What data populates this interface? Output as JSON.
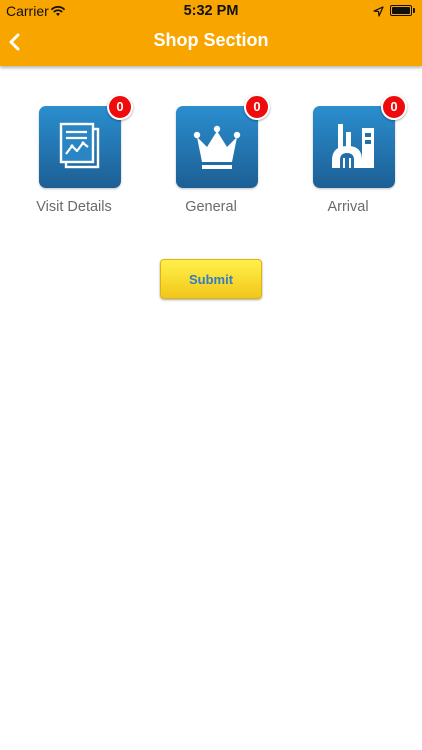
{
  "status_bar": {
    "carrier": "Carrier",
    "time": "5:32 PM"
  },
  "header": {
    "title": "Shop Section",
    "back_icon": "chevron-left-icon",
    "background_color": "#f9a500"
  },
  "tiles": [
    {
      "label": "Visit Details",
      "badge": "0",
      "icon": "document-chart-icon"
    },
    {
      "label": "General",
      "badge": "0",
      "icon": "crown-icon"
    },
    {
      "label": "Arrival",
      "badge": "0",
      "icon": "factory-icon"
    }
  ],
  "submit_button": {
    "label": "Submit"
  },
  "colors": {
    "tile_gradient_top": "#2b8ecf",
    "tile_gradient_bottom": "#1c5f95",
    "badge": "#ef0b0b",
    "submit_text": "#2f7fc4"
  }
}
